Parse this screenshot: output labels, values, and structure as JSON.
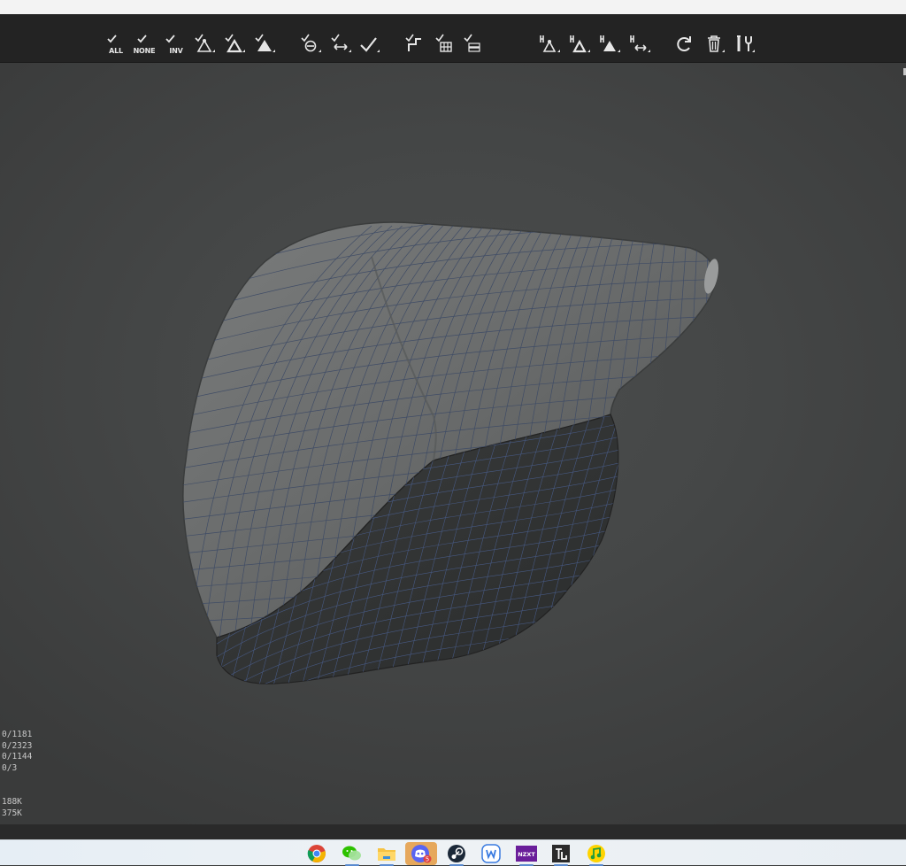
{
  "toolbar": {
    "select_all": "ALL",
    "select_none": "NONE",
    "select_invert": "INV"
  },
  "stats": {
    "lines": [
      "0/1181",
      "0/2323",
      "0/1144",
      "0/3"
    ],
    "memory": [
      "188K",
      "375K"
    ]
  },
  "taskbar": {
    "apps": [
      "chrome-icon",
      "wechat-icon",
      "file-explorer-icon",
      "discord-icon",
      "steam-icon",
      "wps-icon",
      "nzxt-icon",
      "topaz-icon",
      "music-icon"
    ],
    "nzxt_label": "NZXT",
    "discord_badge": "5"
  },
  "colors": {
    "toolbar_bg": "#232323",
    "viewport_bg": "#454747",
    "mesh_light": "#6f7171",
    "mesh_dark": "#2e3030",
    "wire": "#3d4a6a"
  }
}
